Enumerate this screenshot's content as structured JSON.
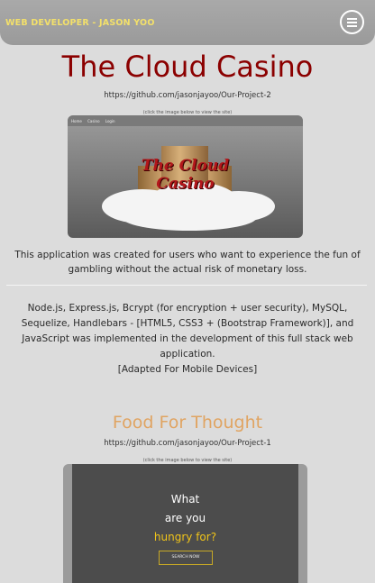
{
  "navbar": {
    "brand": "WEB DEVELOPER - JASON YOO"
  },
  "project1": {
    "title": "The Cloud Casino",
    "url": "https://github.com/jasonjayoo/Our-Project-2",
    "hint": "(click the image below to view the site)",
    "screenshot": {
      "nav_items": [
        "Home",
        "Casino",
        "Login"
      ],
      "logo_line1": "The Cloud",
      "logo_line2": "Casino"
    },
    "description": "This application was created for users who want to experience the fun of gambling without the actual risk of monetary loss.",
    "tech": "Node.js, Express.js, Bcrypt (for encryption + user security), MySQL, Sequelize, Handlebars - [HTML5, CSS3 + (Bootstrap Framework)], and JavaScript was implemented in the development of this full stack web application.",
    "note": "[Adapted For Mobile Devices]"
  },
  "project2": {
    "title": "Food For Thought",
    "url": "https://github.com/jasonjayoo/Our-Project-1",
    "hint": "(click the image below to view the site)",
    "screenshot": {
      "line1": "What",
      "line2": "are you",
      "line3": "hungry for?",
      "button": "SEARCH NOW"
    }
  },
  "colors": {
    "title1": "#8b0000",
    "title2": "#e0a462",
    "brand": "#f3e06a",
    "navbar": "#a0a0a0",
    "background": "#dcdcdc"
  }
}
